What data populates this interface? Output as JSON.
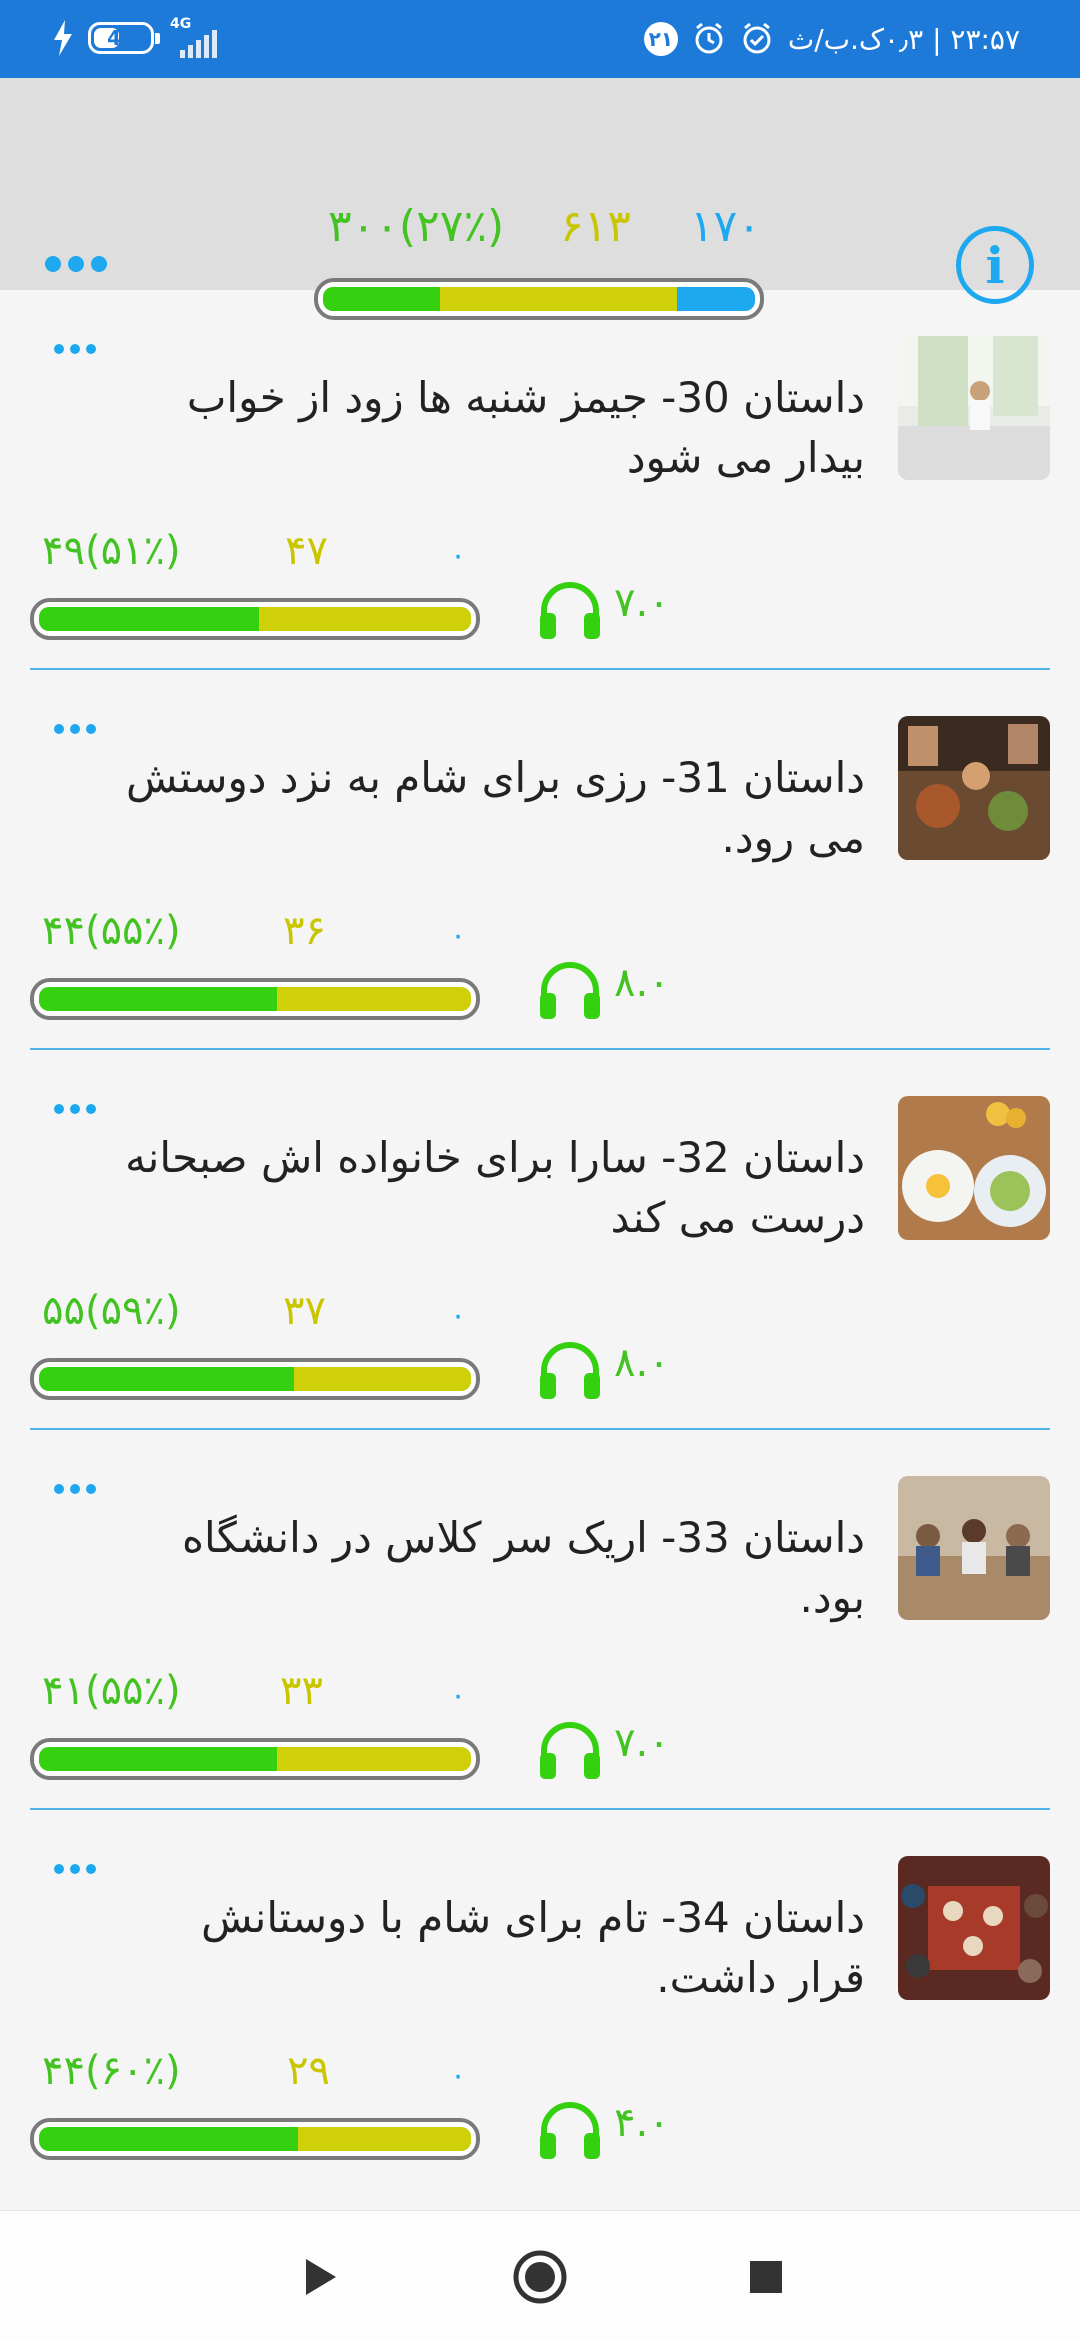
{
  "status_bar": {
    "battery": "41",
    "network": "4G",
    "notification_badge": "۲۱",
    "time_date": "۲۳:۵۷ | ۰٫۳ک.ب/ث"
  },
  "header": {
    "count_green": "۳۰۰(۲۷٪)",
    "count_yellow": "۶۱۳",
    "count_blue": "۱۷۰",
    "progress": {
      "green": 0.27,
      "yellow": 0.55,
      "blue": 0.18
    },
    "info_icon": "info-icon",
    "more_icon": "more-horizontal-icon"
  },
  "stories": [
    {
      "title": "داستان 30- جیمز شنبه ها زود از خواب بیدار می شود",
      "count_green": "۴۹(۵۱٪)",
      "count_yellow": "۴۷",
      "count_blue": "۰",
      "duration": "۷.۰",
      "progress": {
        "green": 0.51,
        "yellow": 0.49
      },
      "thumb": "morning-bedroom"
    },
    {
      "title": "داستان 31- رزی برای شام به نزد دوستش می رود.",
      "count_green": "۴۴(۵۵٪)",
      "count_yellow": "۳۶",
      "count_blue": "۰",
      "duration": "۸.۰",
      "progress": {
        "green": 0.55,
        "yellow": 0.45
      },
      "thumb": "dinner-table"
    },
    {
      "title": "داستان 32- سارا برای خانواده اش صبحانه درست می کند",
      "count_green": "۵۵(۵۹٪)",
      "count_yellow": "۳۷",
      "count_blue": "۰",
      "duration": "۸.۰",
      "progress": {
        "green": 0.59,
        "yellow": 0.41
      },
      "thumb": "breakfast-plates"
    },
    {
      "title": "داستان 33- اریک سر کلاس در دانشگاه بود.",
      "count_green": "۴۱(۵۵٪)",
      "count_yellow": "۳۳",
      "count_blue": "۰",
      "duration": "۷.۰",
      "progress": {
        "green": 0.55,
        "yellow": 0.45
      },
      "thumb": "classroom"
    },
    {
      "title": "داستان 34- تام برای شام با دوستانش قرار داشت.",
      "count_green": "۴۴(۶۰٪)",
      "count_yellow": "۲۹",
      "count_blue": "۰",
      "duration": "۴.۰",
      "progress": {
        "green": 0.6,
        "yellow": 0.4
      },
      "thumb": "friends-dinner"
    }
  ],
  "bottom_nav": {
    "play_icon": "play-icon",
    "record_icon": "record-icon",
    "stop_icon": "stop-icon"
  },
  "colors": {
    "status_bar": "#1e7ad8",
    "accent_blue": "#1ea8f0",
    "green": "#35d111",
    "yellow": "#cfd007"
  }
}
